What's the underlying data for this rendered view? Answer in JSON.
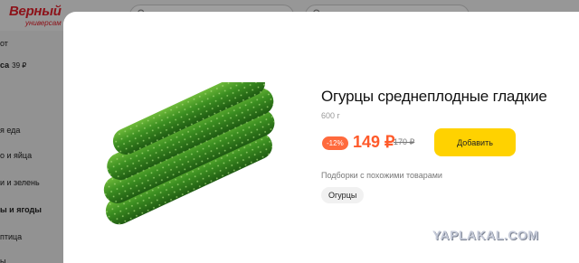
{
  "header": {
    "logo": {
      "name": "Верный",
      "subtitle": "универсам"
    }
  },
  "sidebar": {
    "items": [
      {
        "label": "от"
      },
      {
        "label": "са",
        "price": "39 ₽"
      },
      {
        "label": "я еда"
      },
      {
        "label": "о и яйца"
      },
      {
        "label": "и и зелень"
      },
      {
        "label": "ы и ягоды"
      },
      {
        "label": "птица"
      },
      {
        "label": "ы"
      }
    ]
  },
  "product": {
    "title": "Огурцы среднеплодные гладкие",
    "weight": "600 г",
    "discount": "-12%",
    "price": "149 ₽",
    "old_price": "170 ₽",
    "add_button": "Добавить",
    "similar_label": "Подборки с похожими товарами",
    "tags": [
      "Огурцы"
    ]
  },
  "colors": {
    "accent_button": "#ffd200",
    "price": "#ff5a2a",
    "discount_badge": "#ff6a3d",
    "logo": "#e3202b"
  },
  "watermark": "YAPLAKAL.COM"
}
